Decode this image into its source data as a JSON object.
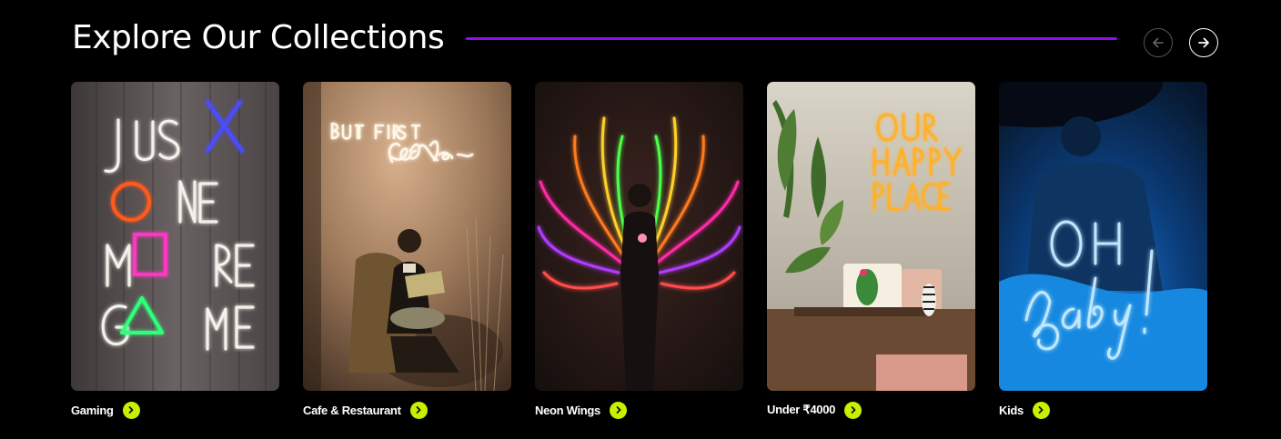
{
  "section": {
    "title": "Explore Our Collections",
    "accent_color": "#8a12ee",
    "prev_icon": "arrow-left-icon",
    "next_icon": "arrow-right-icon"
  },
  "collections": [
    {
      "label": "Gaming",
      "image_sign_text": "JUST ONE MORE GAME",
      "icon": "chevron-right-icon"
    },
    {
      "label": "Cafe & Restaurant",
      "image_sign_text": "BUT FIRST coffee",
      "icon": "chevron-right-icon"
    },
    {
      "label": "Neon Wings",
      "image_sign_text": "",
      "icon": "chevron-right-icon"
    },
    {
      "label": "Under ₹4000",
      "image_sign_text": "OUR HAPPY PLACE",
      "icon": "chevron-right-icon"
    },
    {
      "label": "Kids",
      "image_sign_text": "OH baby!",
      "icon": "chevron-right-icon"
    }
  ],
  "colors": {
    "background": "#000000",
    "go_badge": "#c8f000"
  }
}
